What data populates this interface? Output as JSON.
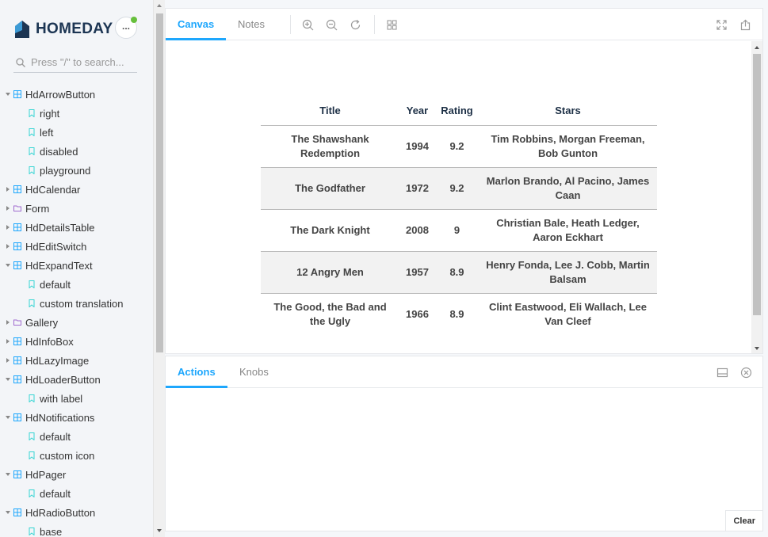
{
  "brand": {
    "name": "HOMEDAY"
  },
  "search": {
    "placeholder": "Press \"/\" to search..."
  },
  "tree": [
    {
      "label": "HdArrowButton",
      "level": 0,
      "type": "component",
      "expanded": true
    },
    {
      "label": "right",
      "level": 1,
      "type": "story"
    },
    {
      "label": "left",
      "level": 1,
      "type": "story"
    },
    {
      "label": "disabled",
      "level": 1,
      "type": "story"
    },
    {
      "label": "playground",
      "level": 1,
      "type": "story"
    },
    {
      "label": "HdCalendar",
      "level": 0,
      "type": "component",
      "expanded": false
    },
    {
      "label": "Form",
      "level": 0,
      "type": "folder",
      "expanded": false
    },
    {
      "label": "HdDetailsTable",
      "level": 0,
      "type": "component",
      "expanded": false
    },
    {
      "label": "HdEditSwitch",
      "level": 0,
      "type": "component",
      "expanded": false
    },
    {
      "label": "HdExpandText",
      "level": 0,
      "type": "component",
      "expanded": true
    },
    {
      "label": "default",
      "level": 1,
      "type": "story"
    },
    {
      "label": "custom translation",
      "level": 1,
      "type": "story"
    },
    {
      "label": "Gallery",
      "level": 0,
      "type": "folder",
      "expanded": false
    },
    {
      "label": "HdInfoBox",
      "level": 0,
      "type": "component",
      "expanded": false
    },
    {
      "label": "HdLazyImage",
      "level": 0,
      "type": "component",
      "expanded": false
    },
    {
      "label": "HdLoaderButton",
      "level": 0,
      "type": "component",
      "expanded": true
    },
    {
      "label": "with label",
      "level": 1,
      "type": "story"
    },
    {
      "label": "HdNotifications",
      "level": 0,
      "type": "component",
      "expanded": true
    },
    {
      "label": "default",
      "level": 1,
      "type": "story"
    },
    {
      "label": "custom icon",
      "level": 1,
      "type": "story"
    },
    {
      "label": "HdPager",
      "level": 0,
      "type": "component",
      "expanded": true
    },
    {
      "label": "default",
      "level": 1,
      "type": "story"
    },
    {
      "label": "HdRadioButton",
      "level": 0,
      "type": "component",
      "expanded": true
    },
    {
      "label": "base",
      "level": 1,
      "type": "story"
    }
  ],
  "toolbar": {
    "tabs": [
      {
        "label": "Canvas",
        "active": true
      },
      {
        "label": "Notes",
        "active": false
      }
    ],
    "icons": [
      "zoom-in-icon",
      "zoom-out-icon",
      "zoom-reset-icon",
      "grid-icon",
      "fullscreen-icon",
      "share-icon"
    ]
  },
  "table": {
    "headers": [
      "Title",
      "Year",
      "Rating",
      "Stars"
    ],
    "rows": [
      [
        "The Shawshank Redemption",
        "1994",
        "9.2",
        "Tim Robbins, Morgan Freeman, Bob Gunton"
      ],
      [
        "The Godfather",
        "1972",
        "9.2",
        "Marlon Brando, Al Pacino, James Caan"
      ],
      [
        "The Dark Knight",
        "2008",
        "9",
        "Christian Bale, Heath Ledger, Aaron Eckhart"
      ],
      [
        "12 Angry Men",
        "1957",
        "8.9",
        "Henry Fonda, Lee J. Cobb, Martin Balsam"
      ],
      [
        "The Good, the Bad and the Ugly",
        "1966",
        "8.9",
        "Clint Eastwood, Eli Wallach, Lee Van Cleef"
      ]
    ]
  },
  "addons": {
    "tabs": [
      {
        "label": "Actions",
        "active": true
      },
      {
        "label": "Knobs",
        "active": false
      }
    ],
    "clear_label": "Clear"
  },
  "colors": {
    "accent": "#1ea7fd",
    "brand_dark": "#1c3553",
    "brand_light": "#3c9bd6",
    "status_green": "#66bf3c",
    "folder": "#a06bcf"
  }
}
